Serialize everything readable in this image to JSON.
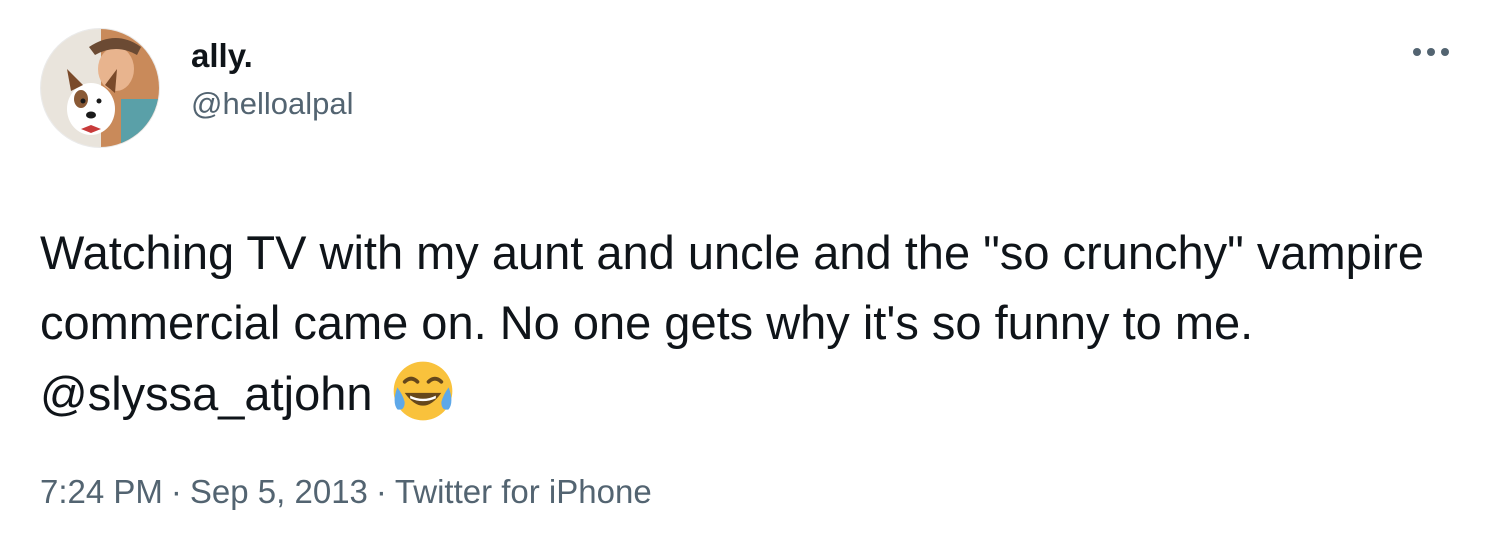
{
  "author": {
    "display_name": "ally.",
    "handle": "@helloalpal",
    "avatar_icon": "user-avatar-photo"
  },
  "menu": {
    "icon": "more-horizontal-icon"
  },
  "tweet": {
    "text_before_mention": "Watching TV with my aunt and uncle and the \"so crunchy\" vampire commercial came on. No one gets why it's so funny to me. ",
    "mention": "@slyssa_atjohn",
    "emoji_icon": "face-with-tears-of-joy-icon"
  },
  "meta": {
    "time": "7:24 PM",
    "separator": "·",
    "date": "Sep 5, 2013",
    "source": "Twitter for iPhone"
  },
  "colors": {
    "text": "#0f1419",
    "secondary": "#536471",
    "emoji_yellow": "#f9c23c",
    "emoji_tears": "#5ea8e8"
  }
}
